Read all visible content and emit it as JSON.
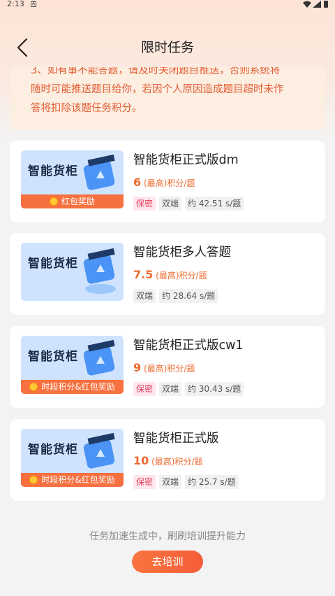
{
  "status_bar": {
    "time": "2:13",
    "notification": "A"
  },
  "header": {
    "title": "限时任务"
  },
  "notice": {
    "lines": [
      "3、如有事不能答题，请及时关闭题目推送，否则系统将",
      "随时可能推送题目给你，若因个人原因造成题目超时未作",
      "答将扣除该题任务积分。"
    ]
  },
  "tasks": [
    {
      "thumb_title": "智能货柜",
      "reward": "红包奖励",
      "name": "智能货柜正式版dm",
      "points": "6",
      "points_suffix": "(最高)积分/题",
      "tags": [
        "保密",
        "双端",
        "约 42.51 s/题"
      ]
    },
    {
      "thumb_title": "智能货柜",
      "reward": "",
      "name": "智能货柜多人答题",
      "points": "7.5",
      "points_suffix": "(最高)积分/题",
      "tags": [
        "双端",
        "约 28.64 s/题"
      ]
    },
    {
      "thumb_title": "智能货柜",
      "reward": "时段积分&红包奖励",
      "name": "智能货柜正式版cw1",
      "points": "9",
      "points_suffix": "(最高)积分/题",
      "tags": [
        "保密",
        "双端",
        "约 30.43 s/题"
      ]
    },
    {
      "thumb_title": "智能货柜",
      "reward": "时段积分&红包奖励",
      "name": "智能货柜正式版",
      "points": "10",
      "points_suffix": "(最高)积分/题",
      "tags": [
        "保密",
        "双端",
        "约 25.7 s/题"
      ]
    }
  ],
  "footer": {
    "message": "任务加速生成中，刷刷培训提升能力",
    "button_label": "去培训"
  },
  "colors": {
    "accent": "#f7703f",
    "points": "#ee6a2e",
    "secret_tag": "#e53e5c",
    "notice_text": "#e25d32"
  }
}
